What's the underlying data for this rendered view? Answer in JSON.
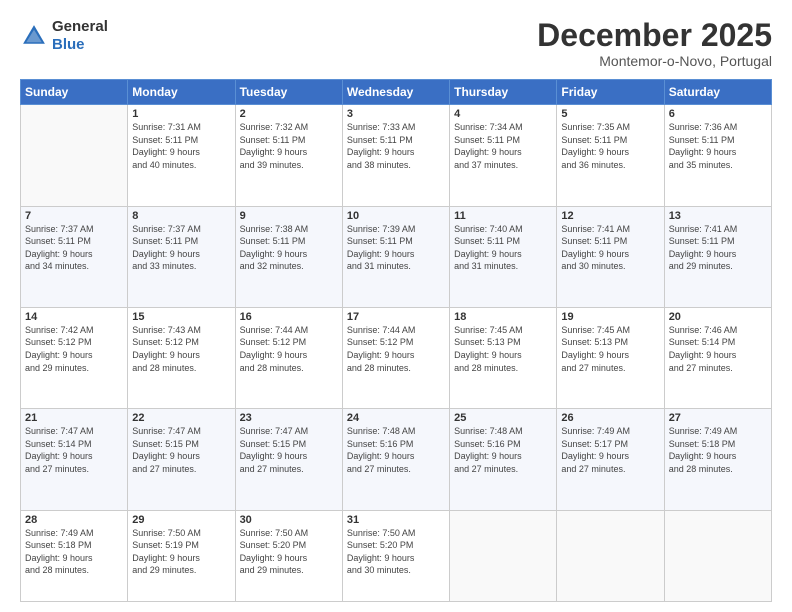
{
  "logo": {
    "line1": "General",
    "line2": "Blue"
  },
  "title": "December 2025",
  "location": "Montemor-o-Novo, Portugal",
  "header_days": [
    "Sunday",
    "Monday",
    "Tuesday",
    "Wednesday",
    "Thursday",
    "Friday",
    "Saturday"
  ],
  "weeks": [
    [
      {
        "day": "",
        "content": ""
      },
      {
        "day": "1",
        "content": "Sunrise: 7:31 AM\nSunset: 5:11 PM\nDaylight: 9 hours\nand 40 minutes."
      },
      {
        "day": "2",
        "content": "Sunrise: 7:32 AM\nSunset: 5:11 PM\nDaylight: 9 hours\nand 39 minutes."
      },
      {
        "day": "3",
        "content": "Sunrise: 7:33 AM\nSunset: 5:11 PM\nDaylight: 9 hours\nand 38 minutes."
      },
      {
        "day": "4",
        "content": "Sunrise: 7:34 AM\nSunset: 5:11 PM\nDaylight: 9 hours\nand 37 minutes."
      },
      {
        "day": "5",
        "content": "Sunrise: 7:35 AM\nSunset: 5:11 PM\nDaylight: 9 hours\nand 36 minutes."
      },
      {
        "day": "6",
        "content": "Sunrise: 7:36 AM\nSunset: 5:11 PM\nDaylight: 9 hours\nand 35 minutes."
      }
    ],
    [
      {
        "day": "7",
        "content": "Sunrise: 7:37 AM\nSunset: 5:11 PM\nDaylight: 9 hours\nand 34 minutes."
      },
      {
        "day": "8",
        "content": "Sunrise: 7:37 AM\nSunset: 5:11 PM\nDaylight: 9 hours\nand 33 minutes."
      },
      {
        "day": "9",
        "content": "Sunrise: 7:38 AM\nSunset: 5:11 PM\nDaylight: 9 hours\nand 32 minutes."
      },
      {
        "day": "10",
        "content": "Sunrise: 7:39 AM\nSunset: 5:11 PM\nDaylight: 9 hours\nand 31 minutes."
      },
      {
        "day": "11",
        "content": "Sunrise: 7:40 AM\nSunset: 5:11 PM\nDaylight: 9 hours\nand 31 minutes."
      },
      {
        "day": "12",
        "content": "Sunrise: 7:41 AM\nSunset: 5:11 PM\nDaylight: 9 hours\nand 30 minutes."
      },
      {
        "day": "13",
        "content": "Sunrise: 7:41 AM\nSunset: 5:11 PM\nDaylight: 9 hours\nand 29 minutes."
      }
    ],
    [
      {
        "day": "14",
        "content": "Sunrise: 7:42 AM\nSunset: 5:12 PM\nDaylight: 9 hours\nand 29 minutes."
      },
      {
        "day": "15",
        "content": "Sunrise: 7:43 AM\nSunset: 5:12 PM\nDaylight: 9 hours\nand 28 minutes."
      },
      {
        "day": "16",
        "content": "Sunrise: 7:44 AM\nSunset: 5:12 PM\nDaylight: 9 hours\nand 28 minutes."
      },
      {
        "day": "17",
        "content": "Sunrise: 7:44 AM\nSunset: 5:12 PM\nDaylight: 9 hours\nand 28 minutes."
      },
      {
        "day": "18",
        "content": "Sunrise: 7:45 AM\nSunset: 5:13 PM\nDaylight: 9 hours\nand 28 minutes."
      },
      {
        "day": "19",
        "content": "Sunrise: 7:45 AM\nSunset: 5:13 PM\nDaylight: 9 hours\nand 27 minutes."
      },
      {
        "day": "20",
        "content": "Sunrise: 7:46 AM\nSunset: 5:14 PM\nDaylight: 9 hours\nand 27 minutes."
      }
    ],
    [
      {
        "day": "21",
        "content": "Sunrise: 7:47 AM\nSunset: 5:14 PM\nDaylight: 9 hours\nand 27 minutes."
      },
      {
        "day": "22",
        "content": "Sunrise: 7:47 AM\nSunset: 5:15 PM\nDaylight: 9 hours\nand 27 minutes."
      },
      {
        "day": "23",
        "content": "Sunrise: 7:47 AM\nSunset: 5:15 PM\nDaylight: 9 hours\nand 27 minutes."
      },
      {
        "day": "24",
        "content": "Sunrise: 7:48 AM\nSunset: 5:16 PM\nDaylight: 9 hours\nand 27 minutes."
      },
      {
        "day": "25",
        "content": "Sunrise: 7:48 AM\nSunset: 5:16 PM\nDaylight: 9 hours\nand 27 minutes."
      },
      {
        "day": "26",
        "content": "Sunrise: 7:49 AM\nSunset: 5:17 PM\nDaylight: 9 hours\nand 27 minutes."
      },
      {
        "day": "27",
        "content": "Sunrise: 7:49 AM\nSunset: 5:18 PM\nDaylight: 9 hours\nand 28 minutes."
      }
    ],
    [
      {
        "day": "28",
        "content": "Sunrise: 7:49 AM\nSunset: 5:18 PM\nDaylight: 9 hours\nand 28 minutes."
      },
      {
        "day": "29",
        "content": "Sunrise: 7:50 AM\nSunset: 5:19 PM\nDaylight: 9 hours\nand 29 minutes."
      },
      {
        "day": "30",
        "content": "Sunrise: 7:50 AM\nSunset: 5:20 PM\nDaylight: 9 hours\nand 29 minutes."
      },
      {
        "day": "31",
        "content": "Sunrise: 7:50 AM\nSunset: 5:20 PM\nDaylight: 9 hours\nand 30 minutes."
      },
      {
        "day": "",
        "content": ""
      },
      {
        "day": "",
        "content": ""
      },
      {
        "day": "",
        "content": ""
      }
    ]
  ]
}
